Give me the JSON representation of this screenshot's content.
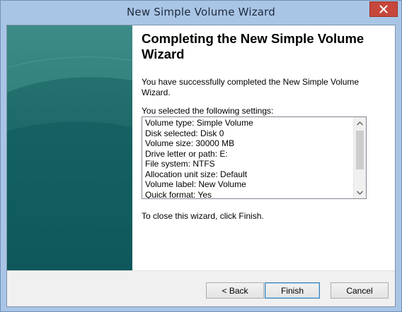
{
  "window": {
    "title": "New Simple Volume Wizard",
    "close_icon": "close-icon",
    "close_color": "#c7473c"
  },
  "side_panel": {
    "colors": [
      "#2f7d7a",
      "#0f5b5d"
    ]
  },
  "content": {
    "heading": "Completing the New Simple Volume Wizard",
    "success_text": "You have successfully completed the New Simple Volume Wizard.",
    "selected_label": "You selected the following settings:",
    "settings": [
      "Volume type: Simple Volume",
      "Disk selected: Disk 0",
      "Volume size: 30000 MB",
      "Drive letter or path: E:",
      "File system: NTFS",
      "Allocation unit size: Default",
      "Volume label: New Volume",
      "Quick format: Yes"
    ],
    "close_instruction": "To close this wizard, click Finish."
  },
  "buttons": {
    "back": "< Back",
    "finish": "Finish",
    "cancel": "Cancel"
  }
}
